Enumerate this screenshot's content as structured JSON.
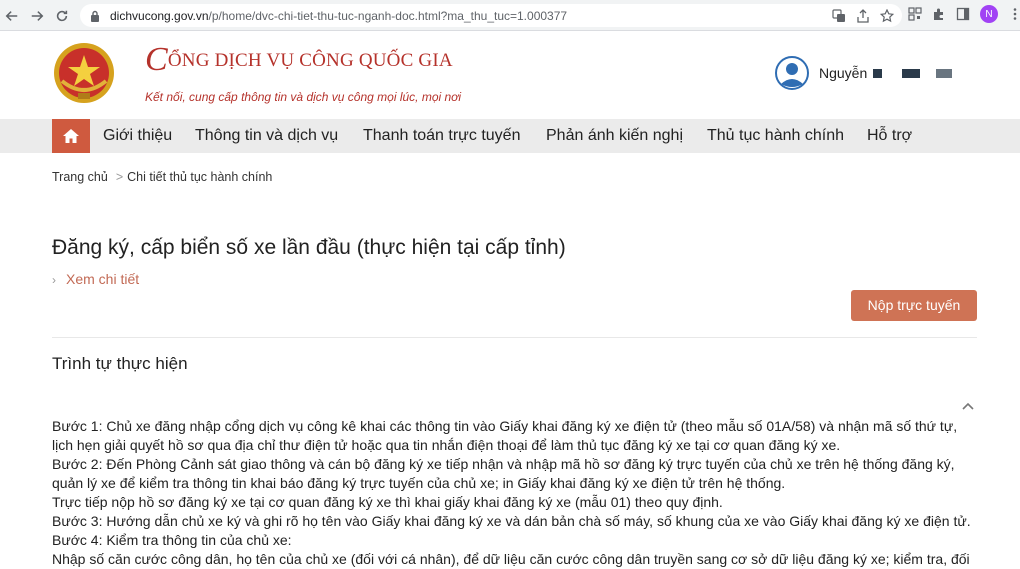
{
  "browser": {
    "url_host": "dichvucong.gov.vn",
    "url_path": "/p/home/dvc-chi-tiet-thu-tuc-nganh-doc.html?ma_thu_tuc=1.000377",
    "profile_initial": "N"
  },
  "header": {
    "title_first_letter": "C",
    "title_rest": "ỔNG DỊCH VỤ CÔNG QUỐC GIA",
    "tagline": "Kết nối, cung cấp thông tin và dịch vụ công mọi lúc, mọi nơi",
    "user_name": "Nguyễn"
  },
  "nav": {
    "items": [
      "Giới thiệu",
      "Thông tin và dịch vụ",
      "Thanh toán trực tuyến",
      "Phản ánh kiến nghị",
      "Thủ tục hành chính",
      "Hỗ trợ"
    ]
  },
  "breadcrumb": {
    "home": "Trang chủ",
    "current": "Chi tiết thủ tục hành chính"
  },
  "main": {
    "title": "Đăng ký, cấp biển số xe lần đầu (thực hiện tại cấp tỉnh)",
    "see_detail": "Xem chi tiết",
    "submit_label": "Nộp trực tuyến",
    "section_title": "Trình tự thực hiện",
    "body_lines": [
      "Bước 1: Chủ xe đăng nhập cổng dịch vụ công kê khai các thông tin vào Giấy khai đăng ký xe điện tử (theo mẫu số 01A/58) và nhận mã số thứ tự,",
      "lịch hẹn giải quyết hồ sơ qua địa chỉ thư điện tử hoặc qua tin nhắn điện thoại để làm thủ tục đăng ký xe tại cơ quan đăng ký xe.",
      "Bước 2: Đến Phòng Cảnh sát giao thông và cán bộ đăng ký xe tiếp nhận và nhập mã hồ sơ đăng ký trực tuyến của chủ xe trên hệ thống đăng ký,",
      "quản lý xe để kiểm tra thông tin khai báo đăng ký trực tuyến của chủ xe; in Giấy khai đăng ký xe điện tử trên hệ thống.",
      "Trực tiếp nộp hồ sơ đăng ký xe tại cơ quan đăng ký xe thì khai giấy khai đăng ký xe (mẫu 01) theo quy định.",
      "Bước 3: Hướng dẫn chủ xe ký và ghi rõ họ tên vào Giấy khai đăng ký xe và dán bản chà số máy, số khung của xe vào Giấy khai đăng ký xe điện tử.",
      "Bước 4: Kiểm tra thông tin của chủ xe:",
      "Nhập số căn cước công dân, họ tên của chủ xe (đối với cá nhân), để dữ liệu căn cước công dân truyền sang cơ sở dữ liệu đăng ký xe; kiểm tra, đối"
    ]
  },
  "colors": {
    "brand_red": "#b5322b",
    "nav_bg": "#ebebeb",
    "home_btn": "#cf5a3f",
    "submit_btn": "#cf7355",
    "link": "#c26a55"
  }
}
